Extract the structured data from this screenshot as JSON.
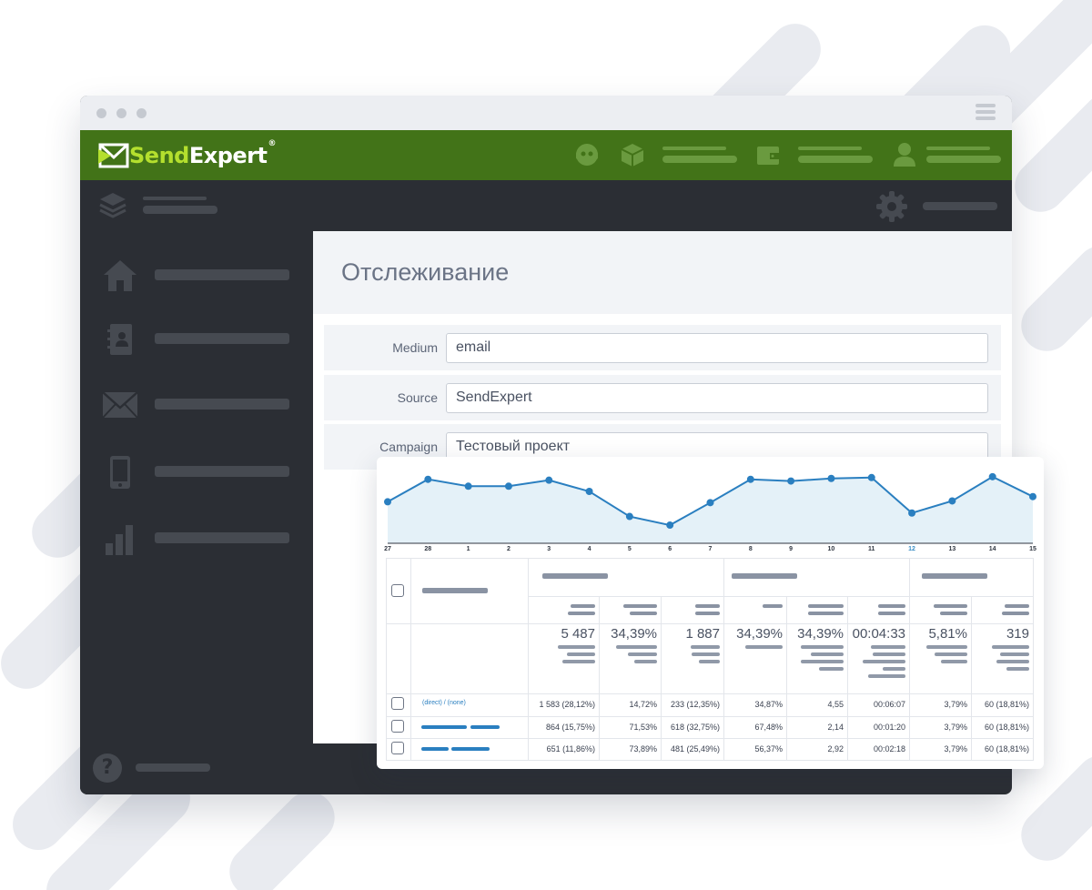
{
  "brand": {
    "logo_send": "Send",
    "logo_expert": "Expert",
    "logo_reg": "®",
    "accent": "#427318",
    "accent_light": "#b4df2e"
  },
  "page": {
    "title": "Отслеживание"
  },
  "form": {
    "medium_label": "Medium",
    "medium_value": "email",
    "source_label": "Source",
    "source_value": "SendExpert",
    "campaign_label": "Campaign",
    "campaign_value": "Тестовый проект"
  },
  "sidebar": {
    "icons": [
      "home-icon",
      "contacts-icon",
      "mail-icon",
      "mobile-icon",
      "stats-icon"
    ],
    "help_icon": "?"
  },
  "chart_data": {
    "type": "area",
    "x": [
      "27",
      "28",
      "1",
      "2",
      "3",
      "4",
      "5",
      "6",
      "7",
      "8",
      "9",
      "10",
      "11",
      "12",
      "13",
      "14",
      "15"
    ],
    "values": [
      48,
      74,
      66,
      66,
      73,
      60,
      31,
      21,
      47,
      74,
      72,
      75,
      76,
      35,
      49,
      77,
      54
    ],
    "ylim": [
      0,
      100
    ],
    "highlighted_x": "12",
    "color": "#2a7fc0",
    "fill": "#e4f1f8"
  },
  "totals": {
    "c1": "5 487",
    "c2": "34,39%",
    "c3": "1 887",
    "c4": "34,39%",
    "c5": "34,39%",
    "c6": "00:04:33",
    "c7": "5,81%",
    "c8": "319"
  },
  "rows": [
    {
      "source": "(direct) / (none)",
      "c1": "1 583 (28,12%)",
      "c2": "14,72%",
      "c3": "233 (12,35%)",
      "c4": "34,87%",
      "c5": "4,55",
      "c6": "00:06:07",
      "c7": "3,79%",
      "c8": "60 (18,81%)"
    },
    {
      "source": "",
      "c1": "864 (15,75%)",
      "c2": "71,53%",
      "c3": "618 (32,75%)",
      "c4": "67,48%",
      "c5": "2,14",
      "c6": "00:01:20",
      "c7": "3,79%",
      "c8": "60 (18,81%)"
    },
    {
      "source": "",
      "c1": "651 (11,86%)",
      "c2": "73,89%",
      "c3": "481 (25,49%)",
      "c4": "56,37%",
      "c5": "2,92",
      "c6": "00:02:18",
      "c7": "3,79%",
      "c8": "60 (18,81%)"
    }
  ]
}
